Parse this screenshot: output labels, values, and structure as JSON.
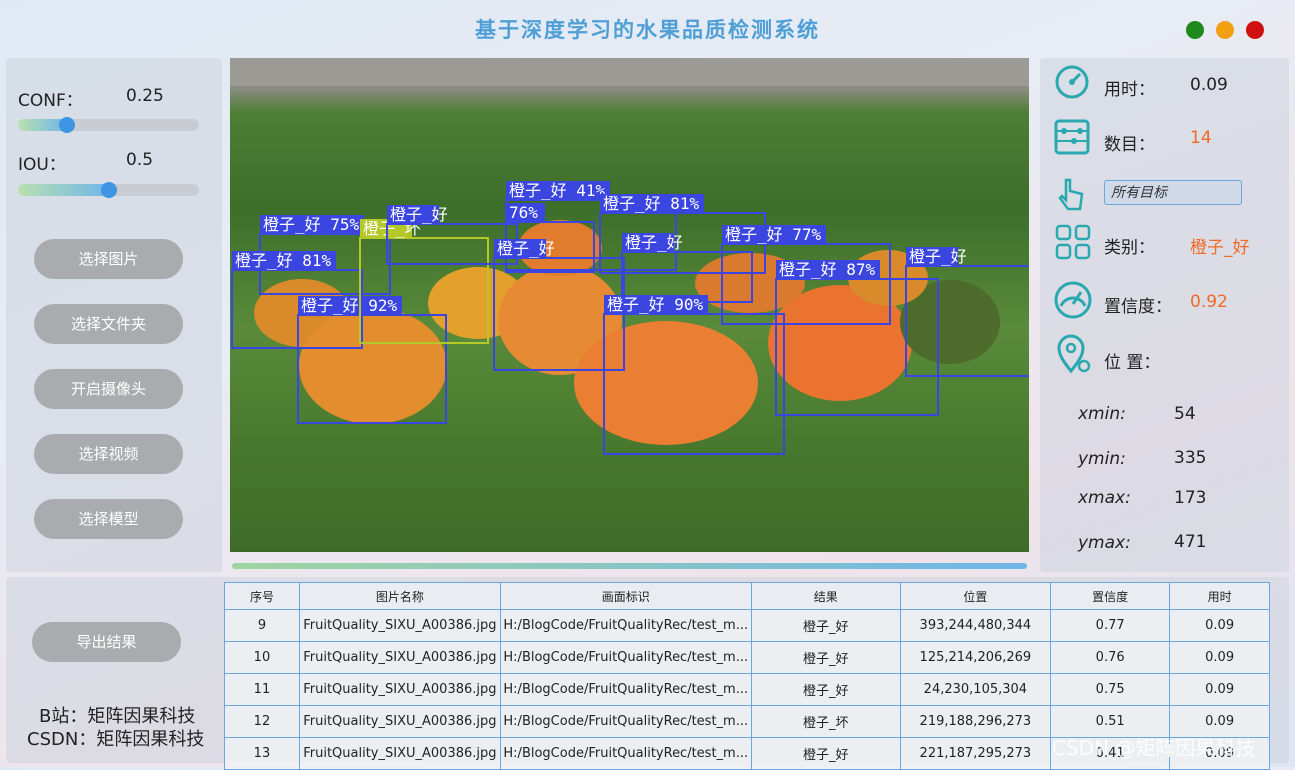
{
  "window": {
    "title": "基于深度学习的水果品质检测系统",
    "controls": [
      {
        "name": "maximize",
        "color": "#1e8a1e"
      },
      {
        "name": "minimize",
        "color": "#f0a010"
      },
      {
        "name": "close",
        "color": "#d01010"
      }
    ]
  },
  "params": {
    "conf_label": "CONF：",
    "conf_value": "0.25",
    "conf_fraction": 0.25,
    "iou_label": "IOU：",
    "iou_value": "0.5",
    "iou_fraction": 0.5
  },
  "buttons": {
    "select_image": "选择图片",
    "select_folder": "选择文件夹",
    "open_camera": "开启摄像头",
    "select_video": "选择视频",
    "select_model": "选择模型",
    "export": "导出结果"
  },
  "detections": [
    {
      "label": "橙子_好 75%",
      "color": "#3b46e0"
    },
    {
      "label": "橙子_好 81%",
      "color": "#3b46e0"
    },
    {
      "label": "橙子_好 92%",
      "color": "#3b46e0"
    },
    {
      "label": "橙子_坏",
      "color": "#b5c82a"
    },
    {
      "label": "橙子_好",
      "color": "#3b46e0"
    },
    {
      "label": "橙子_好 41%",
      "color": "#3b46e0"
    },
    {
      "label": "76%",
      "color": "#3b46e0"
    },
    {
      "label": "橙子_好 81%",
      "color": "#3b46e0"
    },
    {
      "label": "橙子_好",
      "color": "#3b46e0"
    },
    {
      "label": "橙子_好",
      "color": "#3b46e0"
    },
    {
      "label": "橙子_好 77%",
      "color": "#3b46e0"
    },
    {
      "label": "橙子_好 87%",
      "color": "#3b46e0"
    },
    {
      "label": "橙子_好 90%",
      "color": "#3b46e0"
    },
    {
      "label": "橙子_好",
      "color": "#3b46e0"
    }
  ],
  "info": {
    "time_label": "用时：",
    "time_value": "0.09",
    "count_label": "数目：",
    "count_value": "14",
    "target_select": "所有目标",
    "class_label": "类别：",
    "class_value": "橙子_好",
    "conf_label": "置信度：",
    "conf_value": "0.92",
    "position_label": "位 置：",
    "xmin_key": "xmin:",
    "xmin_val": "54",
    "ymin_key": "ymin:",
    "ymin_val": "335",
    "xmax_key": "xmax:",
    "xmax_val": "173",
    "ymax_key": "ymax:",
    "ymax_val": "471",
    "highlight_color": "#f06a24"
  },
  "table": {
    "headers": [
      "序号",
      "图片名称",
      "画面标识",
      "结果",
      "位置",
      "置信度",
      "用时"
    ],
    "rows": [
      [
        "9",
        "FruitQuality_SIXU_A00386.jpg",
        "H:/BlogCode/FruitQualityRec/test_m...",
        "橙子_好",
        "393,244,480,344",
        "0.77",
        "0.09"
      ],
      [
        "10",
        "FruitQuality_SIXU_A00386.jpg",
        "H:/BlogCode/FruitQualityRec/test_m...",
        "橙子_好",
        "125,214,206,269",
        "0.76",
        "0.09"
      ],
      [
        "11",
        "FruitQuality_SIXU_A00386.jpg",
        "H:/BlogCode/FruitQualityRec/test_m...",
        "橙子_好",
        "24,230,105,304",
        "0.75",
        "0.09"
      ],
      [
        "12",
        "FruitQuality_SIXU_A00386.jpg",
        "H:/BlogCode/FruitQualityRec/test_m...",
        "橙子_坏",
        "219,188,296,273",
        "0.51",
        "0.09"
      ],
      [
        "13",
        "FruitQuality_SIXU_A00386.jpg",
        "H:/BlogCode/FruitQualityRec/test_m...",
        "橙子_好",
        "221,187,295,273",
        "0.41",
        "0.09"
      ]
    ]
  },
  "footer": {
    "bilibili": "B站：矩阵因果科技",
    "csdn": "CSDN：矩阵因果科技",
    "watermark": "CSDN @矩阵因果科技"
  }
}
